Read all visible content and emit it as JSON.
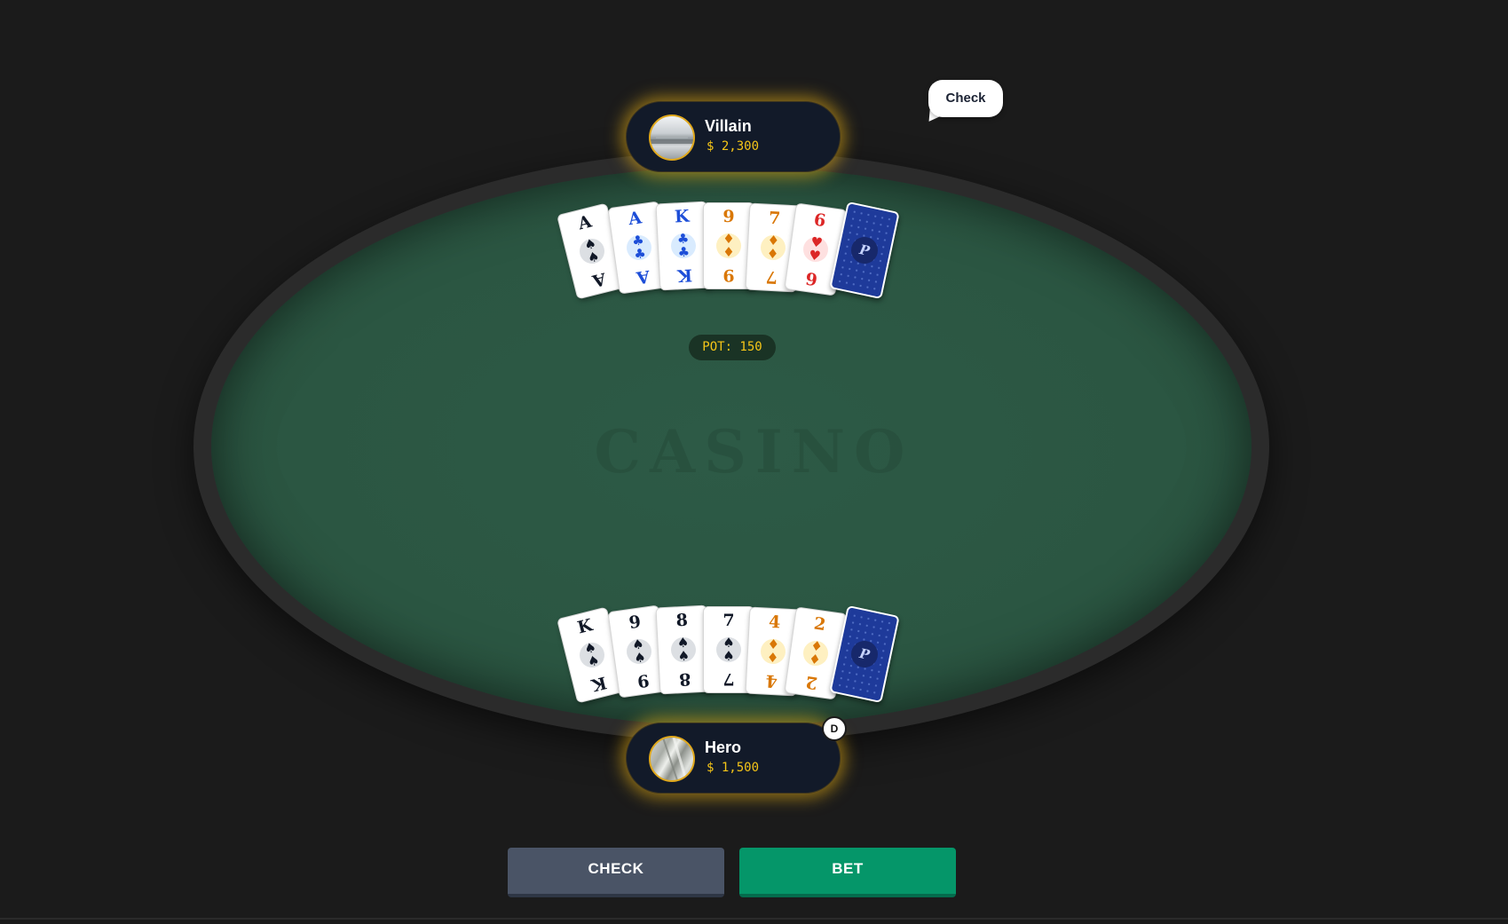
{
  "table": {
    "watermark": "CASINO",
    "pot_label": "POT: 150"
  },
  "villain": {
    "name": "Villain",
    "stack": "$ 2,300",
    "last_action": "Check",
    "cards": [
      {
        "rank": "A",
        "suit": "spades",
        "glyph": "♠",
        "color": "#111827",
        "glow": "#9ca3af"
      },
      {
        "rank": "A",
        "suit": "clubs",
        "glyph": "♣",
        "color": "#1d4ed8",
        "glow": "#93c5fd"
      },
      {
        "rank": "K",
        "suit": "clubs",
        "glyph": "♣",
        "color": "#1d4ed8",
        "glow": "#93c5fd"
      },
      {
        "rank": "9",
        "suit": "diamonds",
        "glyph": "♦",
        "color": "#d97706",
        "glow": "#fcd34d"
      },
      {
        "rank": "7",
        "suit": "diamonds",
        "glyph": "♦",
        "color": "#d97706",
        "glow": "#fcd34d"
      },
      {
        "rank": "6",
        "suit": "hearts",
        "glyph": "♥",
        "color": "#dc2626",
        "glow": "#fca5a5"
      }
    ],
    "back_emblem": "P"
  },
  "hero": {
    "name": "Hero",
    "stack": "$ 1,500",
    "dealer_button": "D",
    "cards": [
      {
        "rank": "K",
        "suit": "spades",
        "glyph": "♠",
        "color": "#111827",
        "glow": "#9ca3af"
      },
      {
        "rank": "9",
        "suit": "spades",
        "glyph": "♠",
        "color": "#111827",
        "glow": "#9ca3af"
      },
      {
        "rank": "8",
        "suit": "spades",
        "glyph": "♠",
        "color": "#111827",
        "glow": "#9ca3af"
      },
      {
        "rank": "7",
        "suit": "spades",
        "glyph": "♠",
        "color": "#111827",
        "glow": "#9ca3af"
      },
      {
        "rank": "4",
        "suit": "diamonds",
        "glyph": "♦",
        "color": "#d97706",
        "glow": "#fcd34d"
      },
      {
        "rank": "2",
        "suit": "diamonds",
        "glyph": "♦",
        "color": "#d97706",
        "glow": "#fcd34d"
      }
    ],
    "back_emblem": "P"
  },
  "actions": {
    "check_label": "CHECK",
    "bet_label": "BET"
  },
  "colors": {
    "felt": "#2d5a46",
    "accent_gold": "#f5c518",
    "bet_green": "#059669",
    "check_gray": "#4a5466"
  }
}
